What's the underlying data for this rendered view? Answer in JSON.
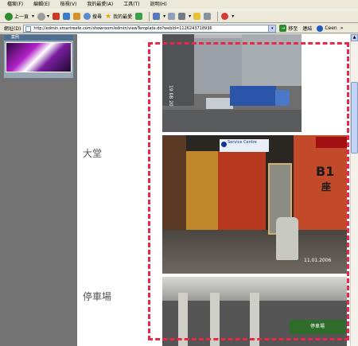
{
  "menubar": {
    "items": [
      "檔案(F)",
      "編輯(E)",
      "檢視(V)",
      "我的最愛(A)",
      "工具(T)",
      "說明(H)"
    ]
  },
  "toolbar": {
    "back_label": "上一頁",
    "search_label": "搜尋",
    "favorites_label": "我的最愛"
  },
  "addressbar": {
    "label": "網址(D)",
    "url": "http://edmin.smartreefe.com/showroom/edmin/viewTemplate.do?webId=1126243718936",
    "go_label": "移至",
    "links_label": "連結",
    "link_ceen": "Ceen"
  },
  "sidebar": {
    "header": "案例"
  },
  "content": {
    "label_lobby": "大堂",
    "label_parking": "停車場",
    "photo1_date": "19 08 20",
    "photo2_sign_text": "Service Centre",
    "photo2_b1": "B1",
    "photo2_seat": "座",
    "photo2_date": "11.01.2006",
    "photo3_banner": "停車場"
  },
  "colors": {
    "frame_border": "#e8274b",
    "sidebar_bg": "#737373",
    "chrome_bg": "#ece9d8"
  }
}
